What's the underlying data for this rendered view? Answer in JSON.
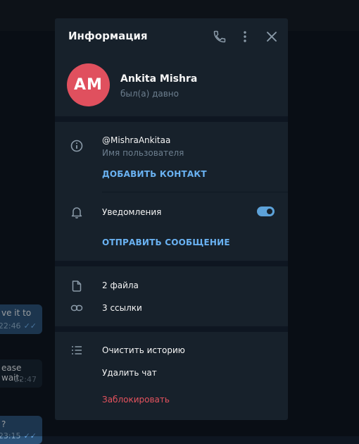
{
  "panel": {
    "title": "Информация",
    "icons": [
      "phone-icon",
      "more-icon",
      "close-icon"
    ]
  },
  "profile": {
    "initials": "AM",
    "avatar_color": "#e0505e",
    "name": "Ankita Mishra",
    "status": "был(а) давно"
  },
  "info": {
    "username": "@MishraAnkitaa",
    "username_caption": "Имя пользователя",
    "add_contact": "ДОБАВИТЬ КОНТАКТ"
  },
  "notifications": {
    "label": "Уведомления",
    "enabled": true,
    "send_message": "ОТПРАВИТЬ СООБЩЕНИЕ"
  },
  "media": {
    "files": "2 файла",
    "links": "3 ссылки"
  },
  "actions": {
    "clear_history": "Очистить историю",
    "delete_chat": "Удалить чат",
    "block": "Заблокировать"
  },
  "background_messages": [
    {
      "text": "ve it to",
      "time": "22:46",
      "read": true
    },
    {
      "text": "ease wait.",
      "time": "22:47"
    },
    {
      "text": "?",
      "time": "23:15",
      "read": true
    }
  ],
  "colors": {
    "accent": "#6ab2f2",
    "danger": "#e5535e",
    "panel_bg": "#17212b",
    "app_bg": "#0e1621"
  }
}
